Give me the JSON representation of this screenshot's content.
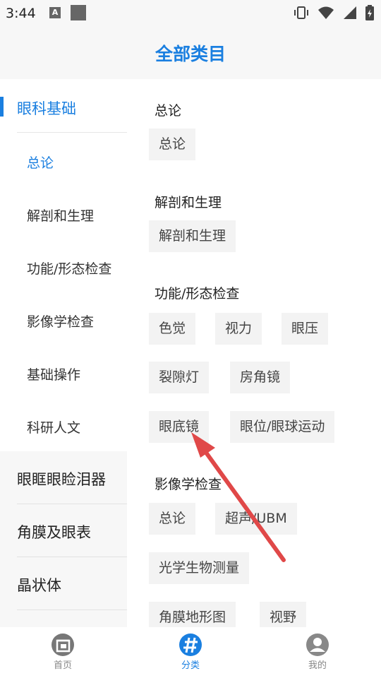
{
  "status_bar": {
    "time": "3:44",
    "a_badge": "A"
  },
  "header": {
    "title": "全部类目"
  },
  "sidebar": {
    "active_group": "眼科基础",
    "sub_items": [
      "总论",
      "解剖和生理",
      "功能/形态检查",
      "影像学检查",
      "基础操作",
      "科研人文"
    ],
    "active_sub_index": 0,
    "groups": [
      "眼眶眼睑泪器",
      "角膜及眼表",
      "晶状体"
    ]
  },
  "content": {
    "sections": [
      {
        "title": "总论",
        "chips": [
          "总论"
        ]
      },
      {
        "title": "解剖和生理",
        "chips": [
          "解剖和生理"
        ]
      },
      {
        "title": "功能/形态检查",
        "chips": [
          "色觉",
          "视力",
          "眼压",
          "裂隙灯",
          "房角镜",
          "眼底镜",
          "眼位/眼球运动"
        ]
      },
      {
        "title": "影像学检查",
        "chips": [
          "总论",
          "超声/UBM",
          "光学生物测量",
          "角膜地形图",
          "视野"
        ]
      }
    ]
  },
  "bottom_nav": {
    "items": [
      {
        "label": "首页",
        "icon": "home-icon"
      },
      {
        "label": "分类",
        "icon": "category-icon"
      },
      {
        "label": "我的",
        "icon": "profile-icon"
      }
    ],
    "active_index": 1
  },
  "colors": {
    "accent": "#1a7fe0",
    "annotation_arrow": "#e04848"
  }
}
